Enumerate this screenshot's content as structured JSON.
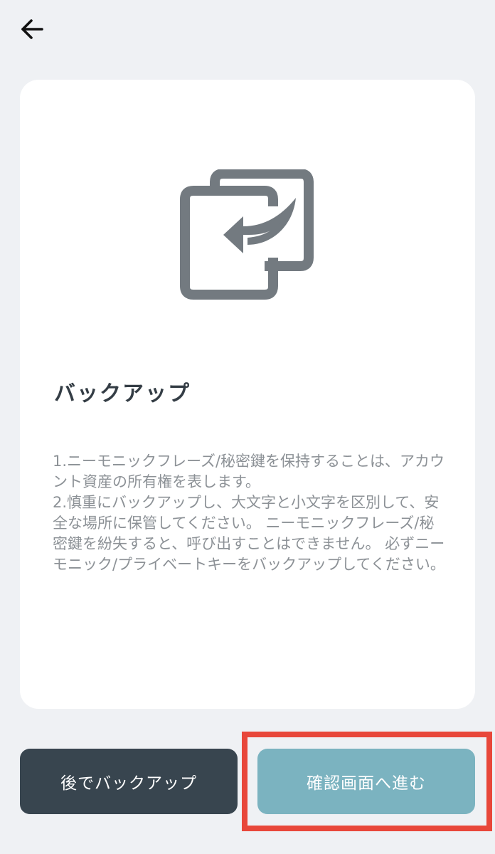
{
  "header": {
    "back_icon": "arrow-left-icon"
  },
  "card": {
    "icon": "backup-copy-icon",
    "title": "バックアップ",
    "description": [
      "1.ニーモニックフレーズ/秘密鍵を保持することは、アカウント資産の所有権を表します。",
      "2.慎重にバックアップし、大文字と小文字を区別して、安全な場所に保管してください。 ニーモニックフレーズ/秘密鍵を紛失すると、呼び出すことはできません。 必ずニーモニック/プライベートキーをバックアップしてください。"
    ]
  },
  "buttons": {
    "later_label": "後でバックアップ",
    "confirm_label": "確認画面へ進む"
  },
  "colors": {
    "background": "#eff1f4",
    "card": "#ffffff",
    "icon": "#737a80",
    "later_button": "#38454f",
    "confirm_button": "#7bb3c0",
    "highlight": "#e8473a"
  }
}
